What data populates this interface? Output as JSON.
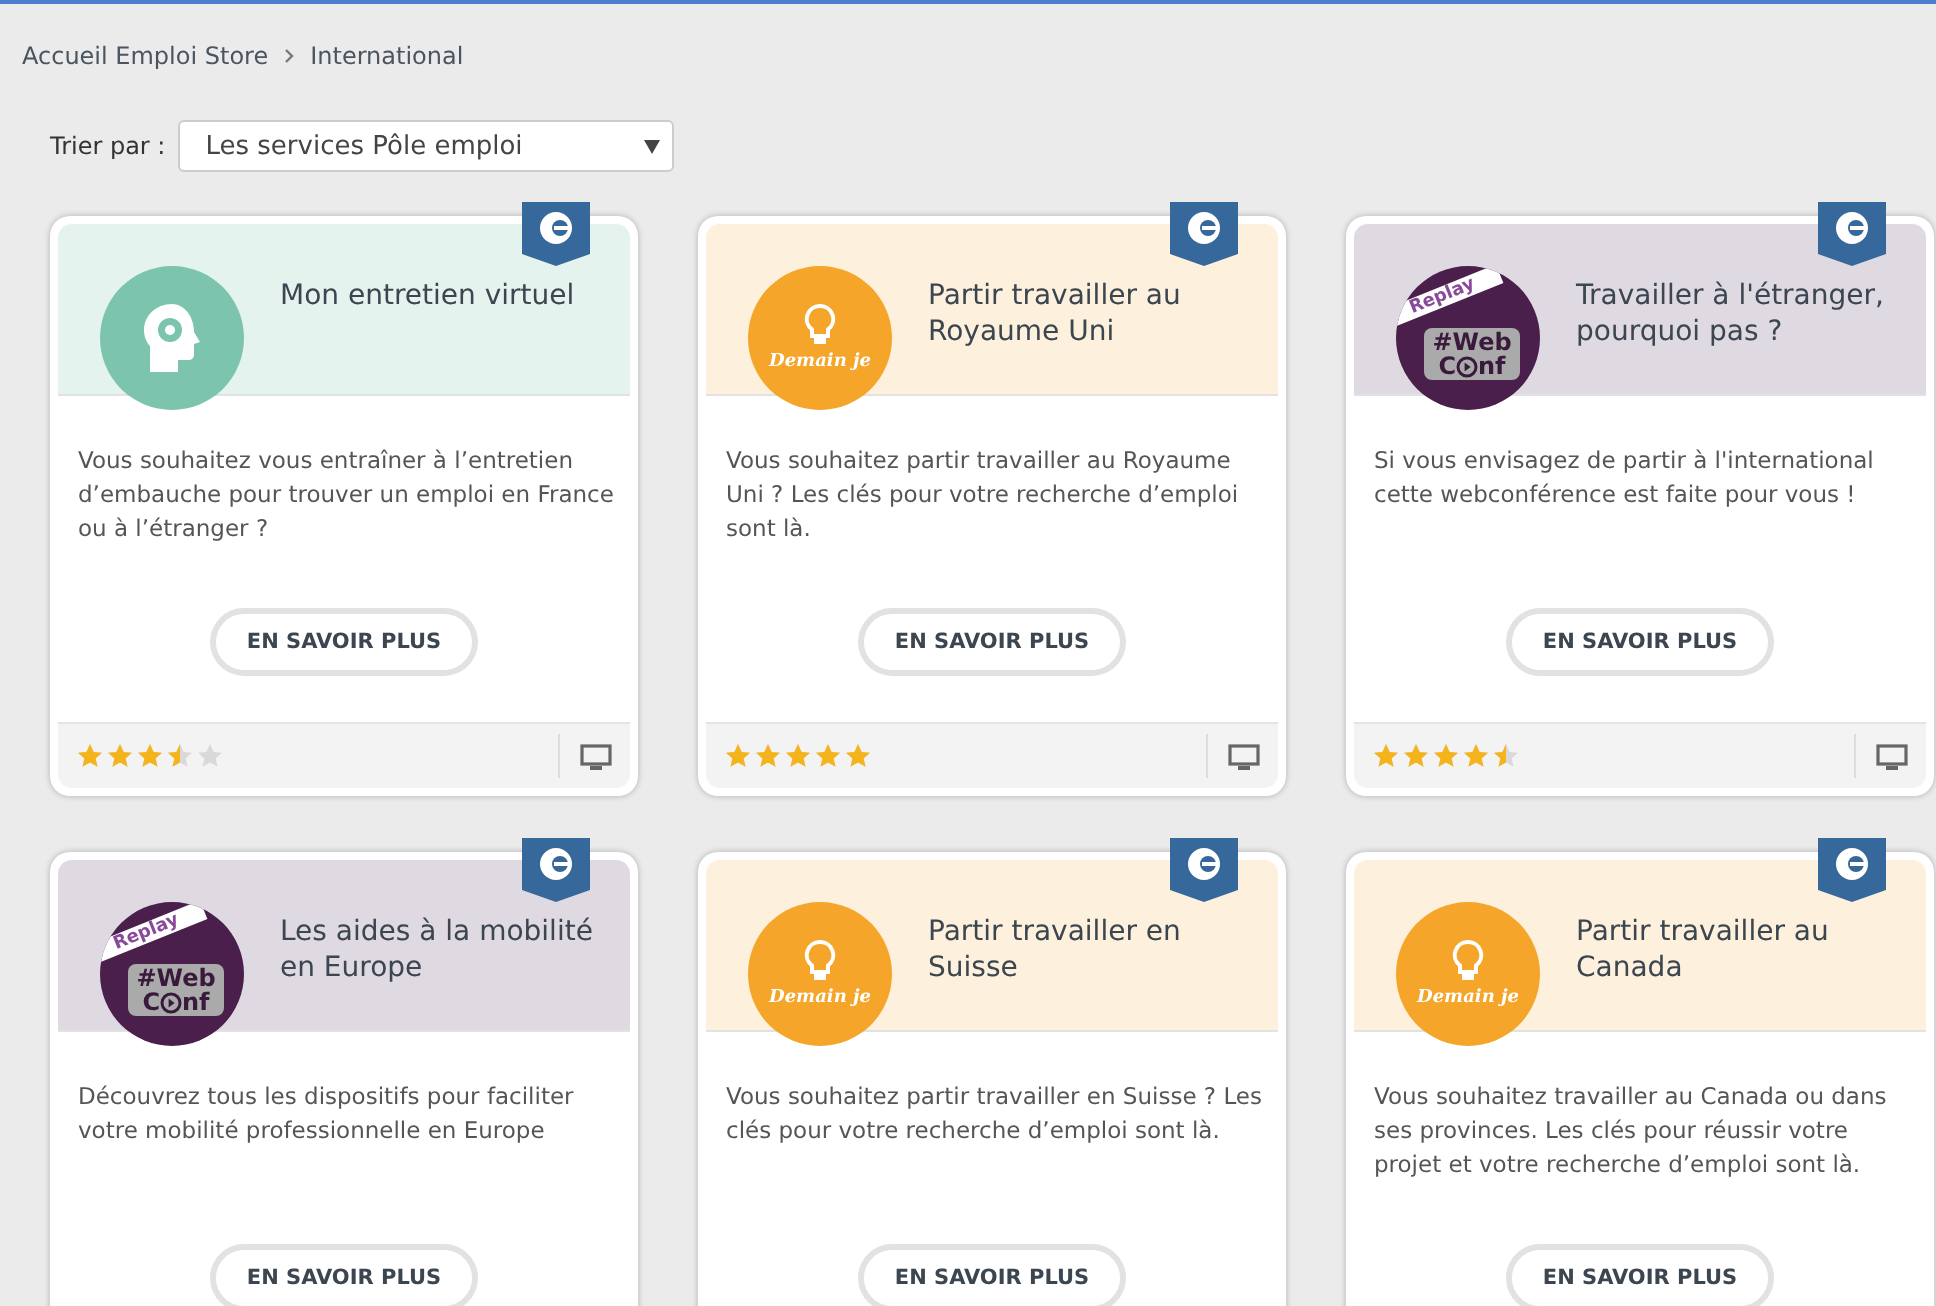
{
  "breadcrumb": [
    "Accueil Emploi Store",
    "International"
  ],
  "sort": {
    "label": "Trier par :",
    "value": "Les services Pôle emploi"
  },
  "cards": [
    {
      "kind": "virtual",
      "title": "Mon entretien virtuel",
      "description": "Vous souhaitez vous entraîner à l’entretien d’embauche pour trouver un emploi en France ou à l’étranger ?",
      "button": "EN SAVOIR PLUS",
      "stars": 3.5
    },
    {
      "kind": "demain",
      "logo_text": "Demain je",
      "title": "Partir travailler au Royaume Uni",
      "description": "Vous souhaitez partir travailler au Royaume Uni ? Les clés pour votre recherche d’emploi sont là.",
      "button": "EN SAVOIR PLUS",
      "stars": 5
    },
    {
      "kind": "webconf",
      "logo_badge": "Replay",
      "logo_line": "#Web",
      "logo_start": "C",
      "logo_end": "nf",
      "title": "Travailler à l'étranger, pourquoi pas ?",
      "description": "Si vous envisagez de partir à l'international cette webconférence est faite pour vous !",
      "button": "EN SAVOIR PLUS",
      "stars": 4.5
    },
    {
      "kind": "webconf",
      "logo_badge": "Replay",
      "logo_line": "#Web",
      "logo_start": "C",
      "logo_end": "nf",
      "title": "Les aides à la mobilité en Europe",
      "description": "Découvrez tous les dispositifs pour faciliter votre mobilité professionnelle en Europe",
      "button": "EN SAVOIR PLUS"
    },
    {
      "kind": "demain",
      "logo_text": "Demain je",
      "title": "Partir travailler en Suisse",
      "description": "Vous souhaitez partir travailler en Suisse ? Les clés pour votre recherche d’emploi sont là.",
      "button": "EN SAVOIR PLUS"
    },
    {
      "kind": "demain",
      "logo_text": "Demain je",
      "title": "Partir travailler au Canada",
      "description": "Vous souhaitez travailler au Canada ou dans ses provinces. Les clés pour réussir votre projet et votre recherche d’emploi sont là.",
      "button": "EN SAVOIR PLUS"
    }
  ]
}
